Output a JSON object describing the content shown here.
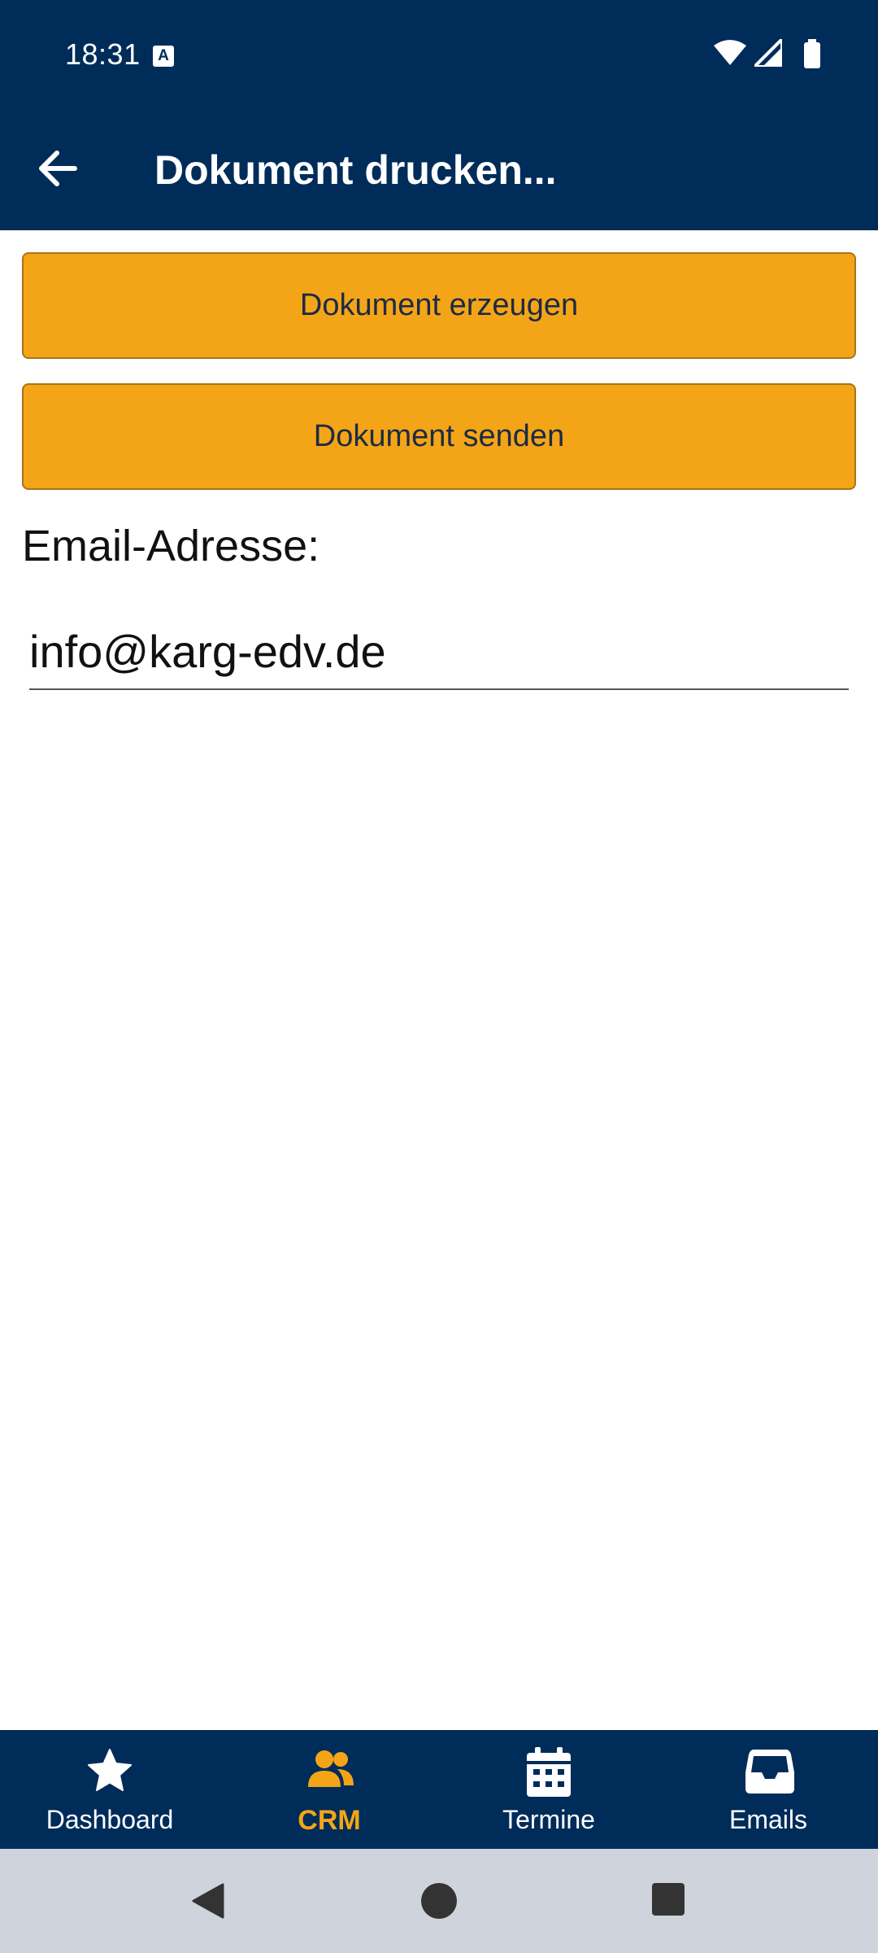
{
  "status_bar": {
    "time": "18:31",
    "notification_icon": "A"
  },
  "app_bar": {
    "title": "Dokument drucken...",
    "back_icon": "arrow-left-icon"
  },
  "actions": {
    "generate_label": "Dokument erzeugen",
    "send_label": "Dokument senden"
  },
  "email": {
    "label": "Email-Adresse:",
    "value": "info@karg-edv.de"
  },
  "bottom_nav": {
    "items": [
      {
        "label": "Dashboard",
        "icon": "star-icon",
        "active": false
      },
      {
        "label": "CRM",
        "icon": "users-icon",
        "active": true
      },
      {
        "label": "Termine",
        "icon": "calendar-icon",
        "active": false
      },
      {
        "label": "Emails",
        "icon": "inbox-icon",
        "active": false
      }
    ]
  },
  "colors": {
    "primary": "#002c5a",
    "accent": "#f4a517",
    "system_nav": "#cfd4dc"
  }
}
